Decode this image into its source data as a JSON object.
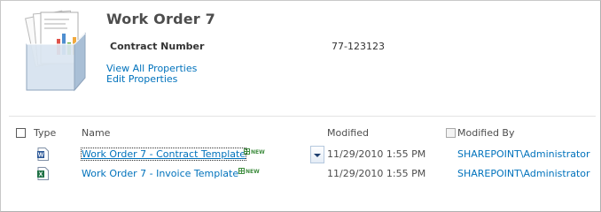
{
  "doc_set": {
    "title": "Work Order 7",
    "properties": [
      {
        "label": "Contract Number",
        "value": "77-123123"
      }
    ],
    "links": {
      "view_all": "View All Properties",
      "edit": "Edit Properties"
    }
  },
  "list": {
    "headers": {
      "type": "Type",
      "name": "Name",
      "modified": "Modified",
      "modified_by": "Modified By"
    },
    "items": [
      {
        "name": "Work Order 7 - Contract Template",
        "file_icon": "word-document-icon",
        "badge": "NEW",
        "modified": "11/29/2010 1:55 PM",
        "modified_by": "SHAREPOINT\\Administrator",
        "selected": true
      },
      {
        "name": "Work Order 7 - Invoice Template",
        "file_icon": "excel-workbook-icon",
        "badge": "NEW",
        "modified": "11/29/2010 1:55 PM",
        "modified_by": "SHAREPOINT\\Administrator",
        "selected": false
      }
    ]
  },
  "colors": {
    "link": "#0072bc",
    "title": "#4d4d4d",
    "new_badge": "#3f8d3f",
    "word_icon": "#2b5797",
    "excel_icon": "#1e7145"
  }
}
